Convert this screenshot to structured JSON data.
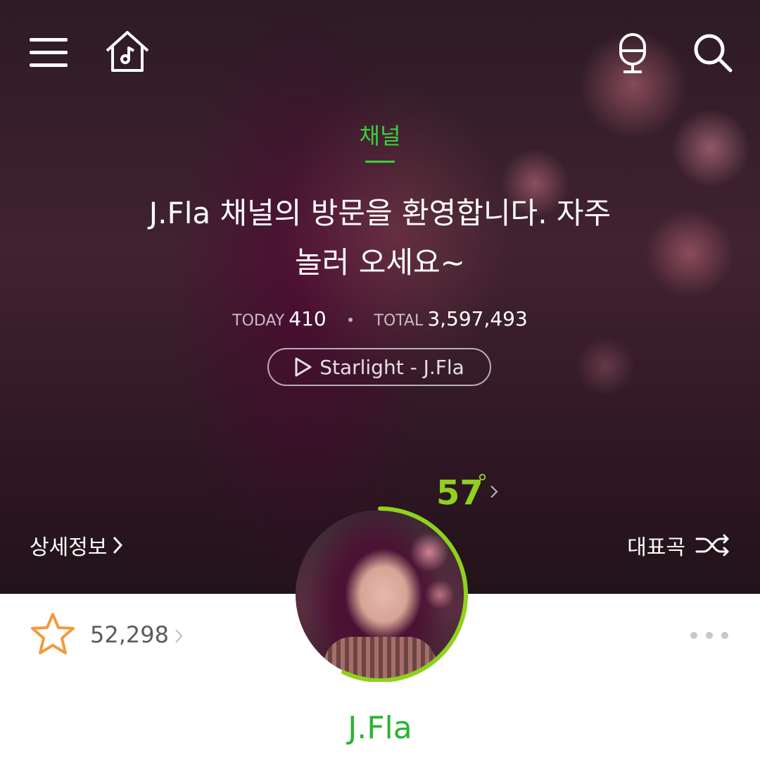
{
  "header": {
    "icons": [
      "menu-icon",
      "music-home-icon",
      "microphone-icon",
      "search-icon"
    ]
  },
  "channel": {
    "label": "채널",
    "welcome_line1": "J.Fla 채널의 방문을 환영합니다. 자주",
    "welcome_line2": "놀러 오세요~",
    "today_label": "TODAY",
    "today_value": "410",
    "total_label": "TOTAL",
    "total_value": "3,597,493",
    "song": "Starlight - J.Fla"
  },
  "temperature": {
    "value": "57",
    "unit": "°",
    "level": 0.57
  },
  "links": {
    "detail": "상세정보",
    "representative": "대표곡"
  },
  "fans": {
    "count": "52,298"
  },
  "artist": {
    "name": "J.Fla"
  },
  "colors": {
    "accent_green": "#2ab531",
    "temp_green": "#8fd11e",
    "star_orange": "#f39a3c"
  }
}
